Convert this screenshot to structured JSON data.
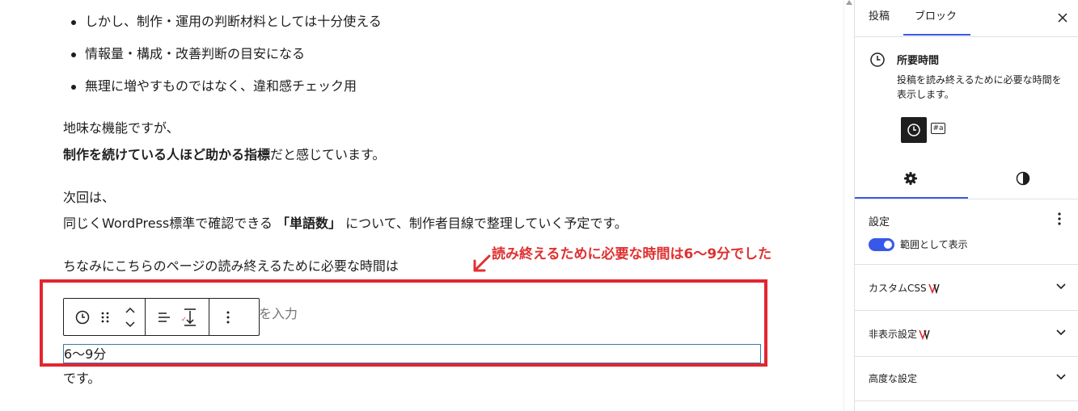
{
  "content": {
    "bullets": [
      "しかし、制作・運用の判断材料としては十分使える",
      "情報量・構成・改善判断の目安になる",
      "無理に増やすものではなく、違和感チェック用"
    ],
    "para1_line1": "地味な機能ですが、",
    "para1_bold": "制作を続けている人ほど助かる指標",
    "para1_rest": "だと感じています。",
    "para2_line1": "次回は、",
    "para2_pre": "同じくWordPress標準で確認できる",
    "para2_bold": "「単語数」",
    "para2_post": "について、制作者目線で整理していく予定です。",
    "para3": "ちなみにこちらのページの読み終えるために必要な時間は",
    "placeholder_text": "を入力",
    "reading_time_value": "6〜9分",
    "after_text": "です。"
  },
  "annotation": {
    "text": "読み終えるために必要な時間は6〜9分でした",
    "color": "#e03131"
  },
  "toolbar": {
    "icons": [
      "clock-icon",
      "drag-handle-icon",
      "move-arrows-icon",
      "align-icon",
      "height-icon",
      "more-options-icon"
    ]
  },
  "sidebar": {
    "tabs": [
      "投稿",
      "ブロック"
    ],
    "active_tab": "ブロック",
    "block_title": "所要時間",
    "block_description": "投稿を読み終えるために必要な時間を表示します。",
    "style_badge": "#a",
    "settings_title": "設定",
    "toggle_label": "範囲として表示",
    "toggle_on": true,
    "panels": [
      "カスタムCSS",
      "非表示設定",
      "高度な設定"
    ],
    "accent_color": "#3858e9"
  }
}
